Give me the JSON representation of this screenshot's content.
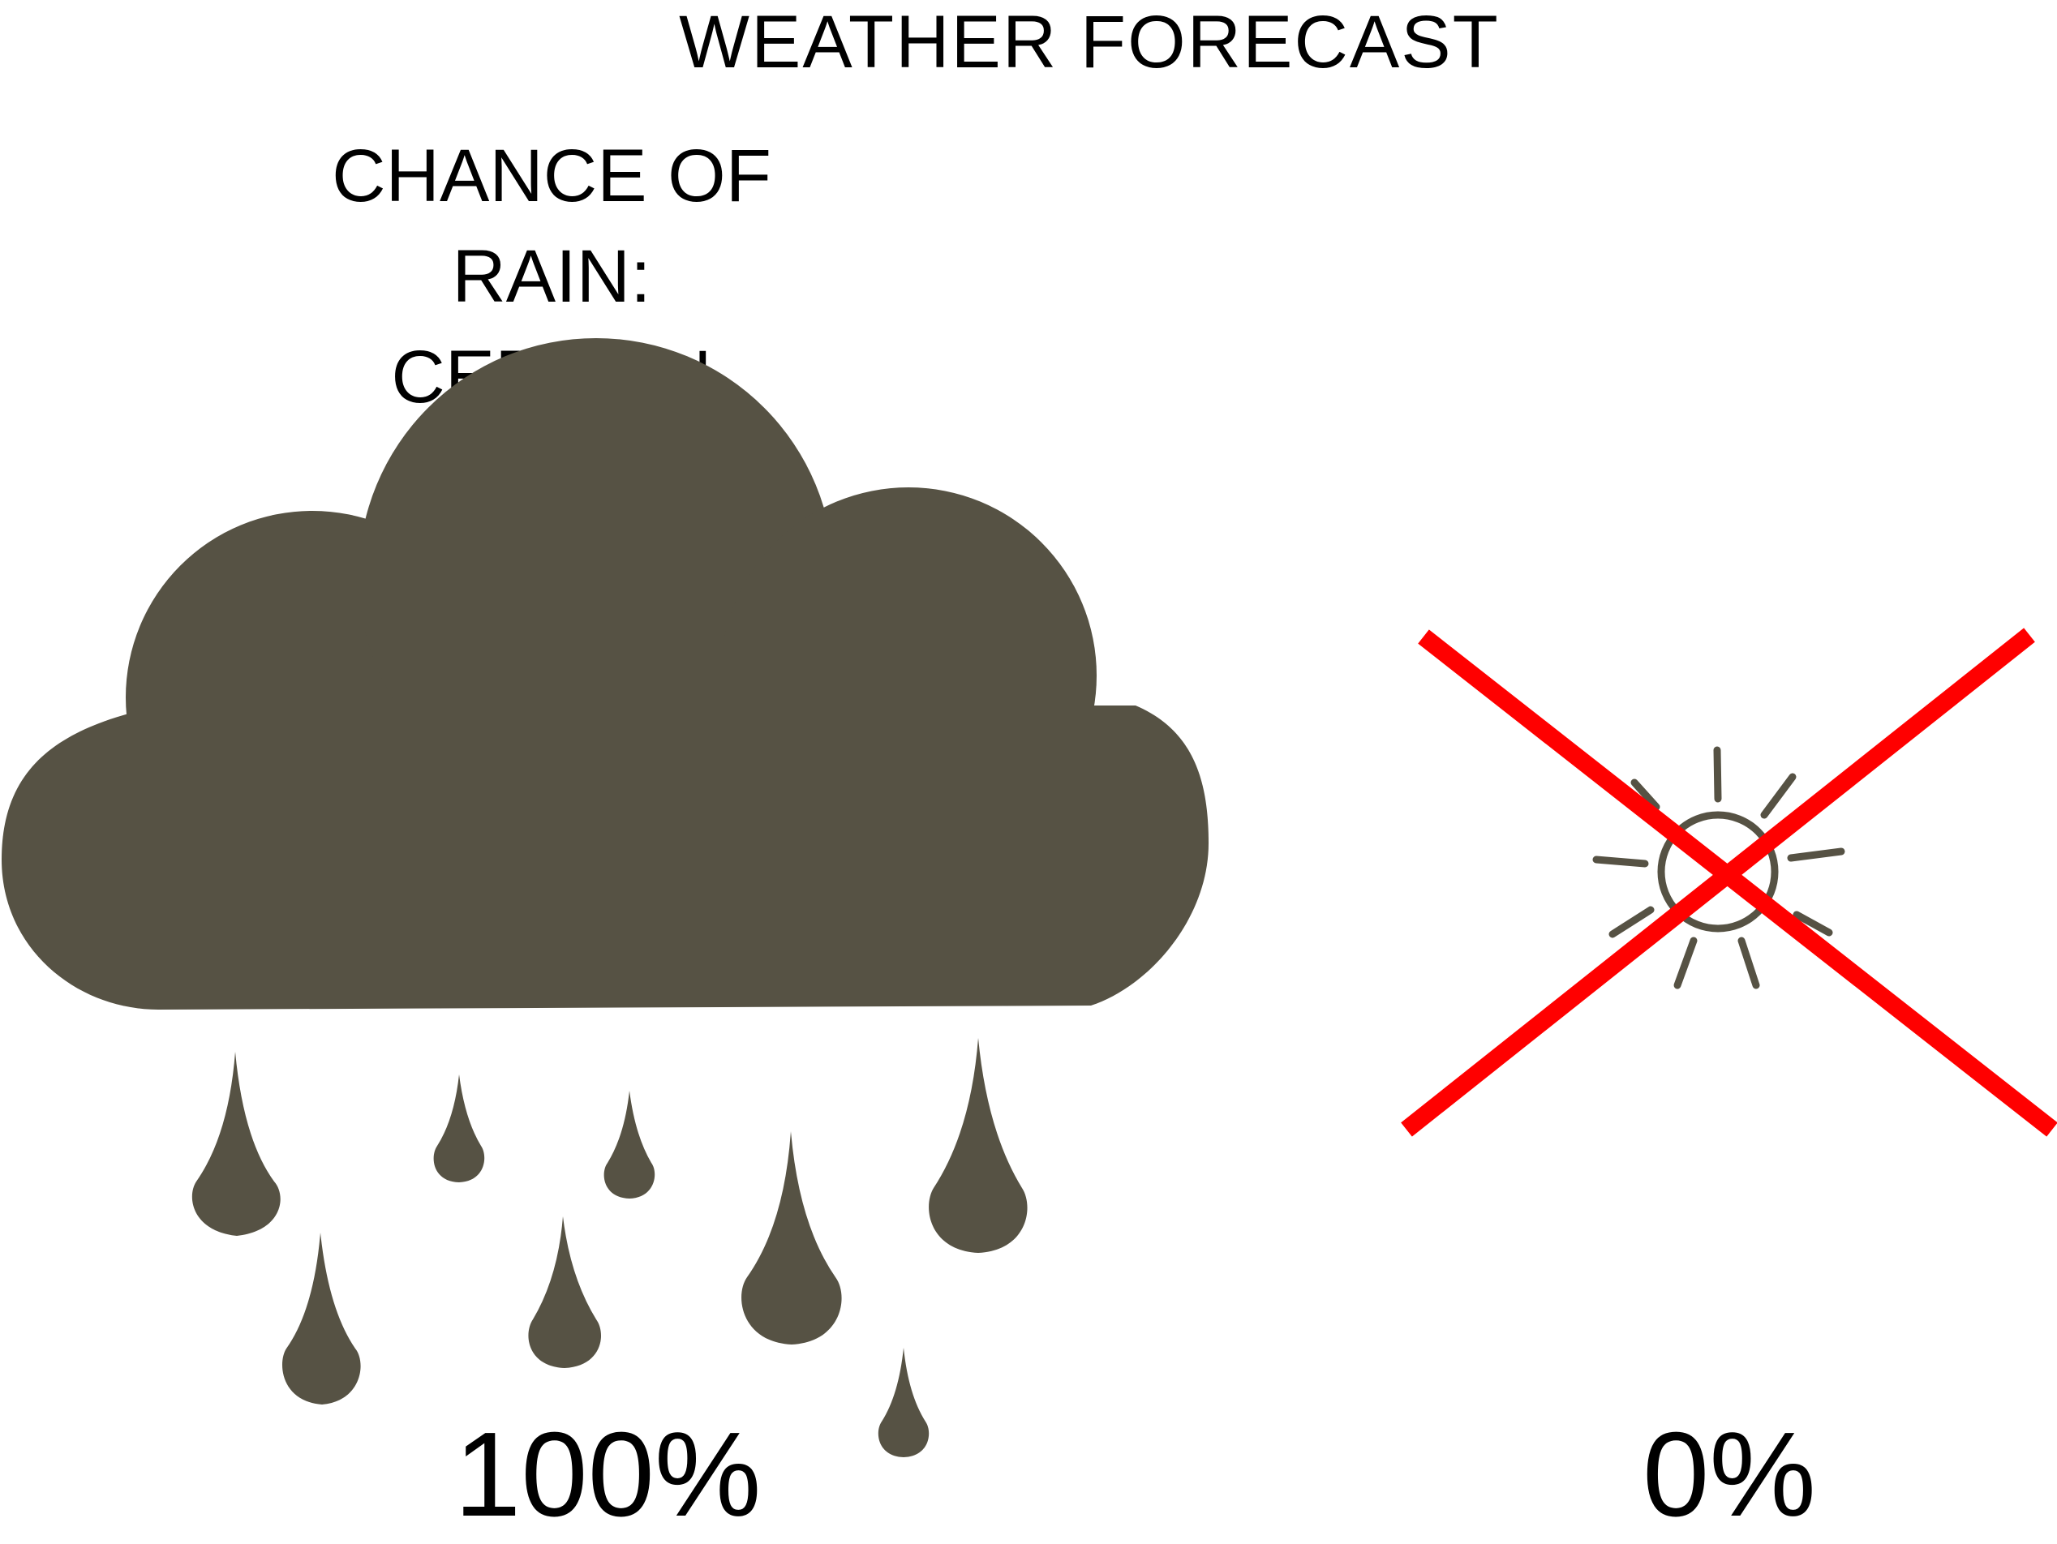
{
  "heading": "WEATHER FORECAST",
  "rain_label": {
    "line1": "CHANCE OF RAIN:",
    "line2": "CERTAIN"
  },
  "rain_percent": "100%",
  "sun_percent": "0%",
  "icons": {
    "cloud": "rain-cloud-icon",
    "drops": "raindrop-icon",
    "sun": "sun-icon",
    "cross": "red-x-icon"
  },
  "colors": {
    "cloud": "#565244",
    "cross": "#ff0000",
    "text": "#000000",
    "background": "#ffffff"
  }
}
